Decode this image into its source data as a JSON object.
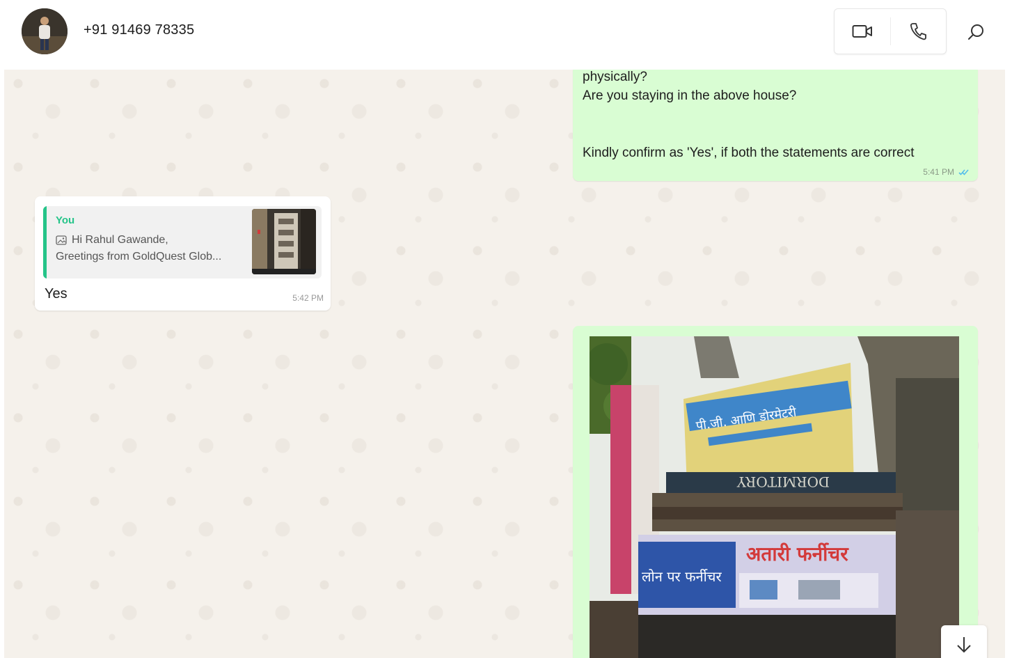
{
  "header": {
    "contact_name": "+91 91469 78335",
    "icons": [
      "video-call-icon",
      "voice-call-icon",
      "search-icon"
    ]
  },
  "messages": [
    {
      "direction": "outgoing",
      "lines": [
        "physically?",
        "Are you staying in the above house?",
        "",
        "Kindly confirm as 'Yes', if both the statements are correct"
      ],
      "time": "5:41 PM",
      "status": "read"
    },
    {
      "direction": "incoming",
      "quoted": {
        "author": "You",
        "line1": "Hi Rahul Gawande,",
        "line2": "Greetings from GoldQuest Glob...",
        "icon": "image-icon"
      },
      "text": "Yes",
      "time": "5:42 PM"
    },
    {
      "direction": "outgoing",
      "type": "image",
      "image_text": {
        "sign_top": "पी.जी. आणि डोरमेटरी",
        "sign_mid": "DORMITORY",
        "sign_bottom": "अतारी फर्नीचर",
        "sign_left": "लोन पर फर्नीचर"
      }
    }
  ],
  "colors": {
    "outgoing_bubble": "#d9fdd3",
    "incoming_bubble": "#ffffff",
    "chat_background": "#f5f1eb",
    "quote_accent": "#25c489",
    "read_ticks": "#53bdeb"
  }
}
